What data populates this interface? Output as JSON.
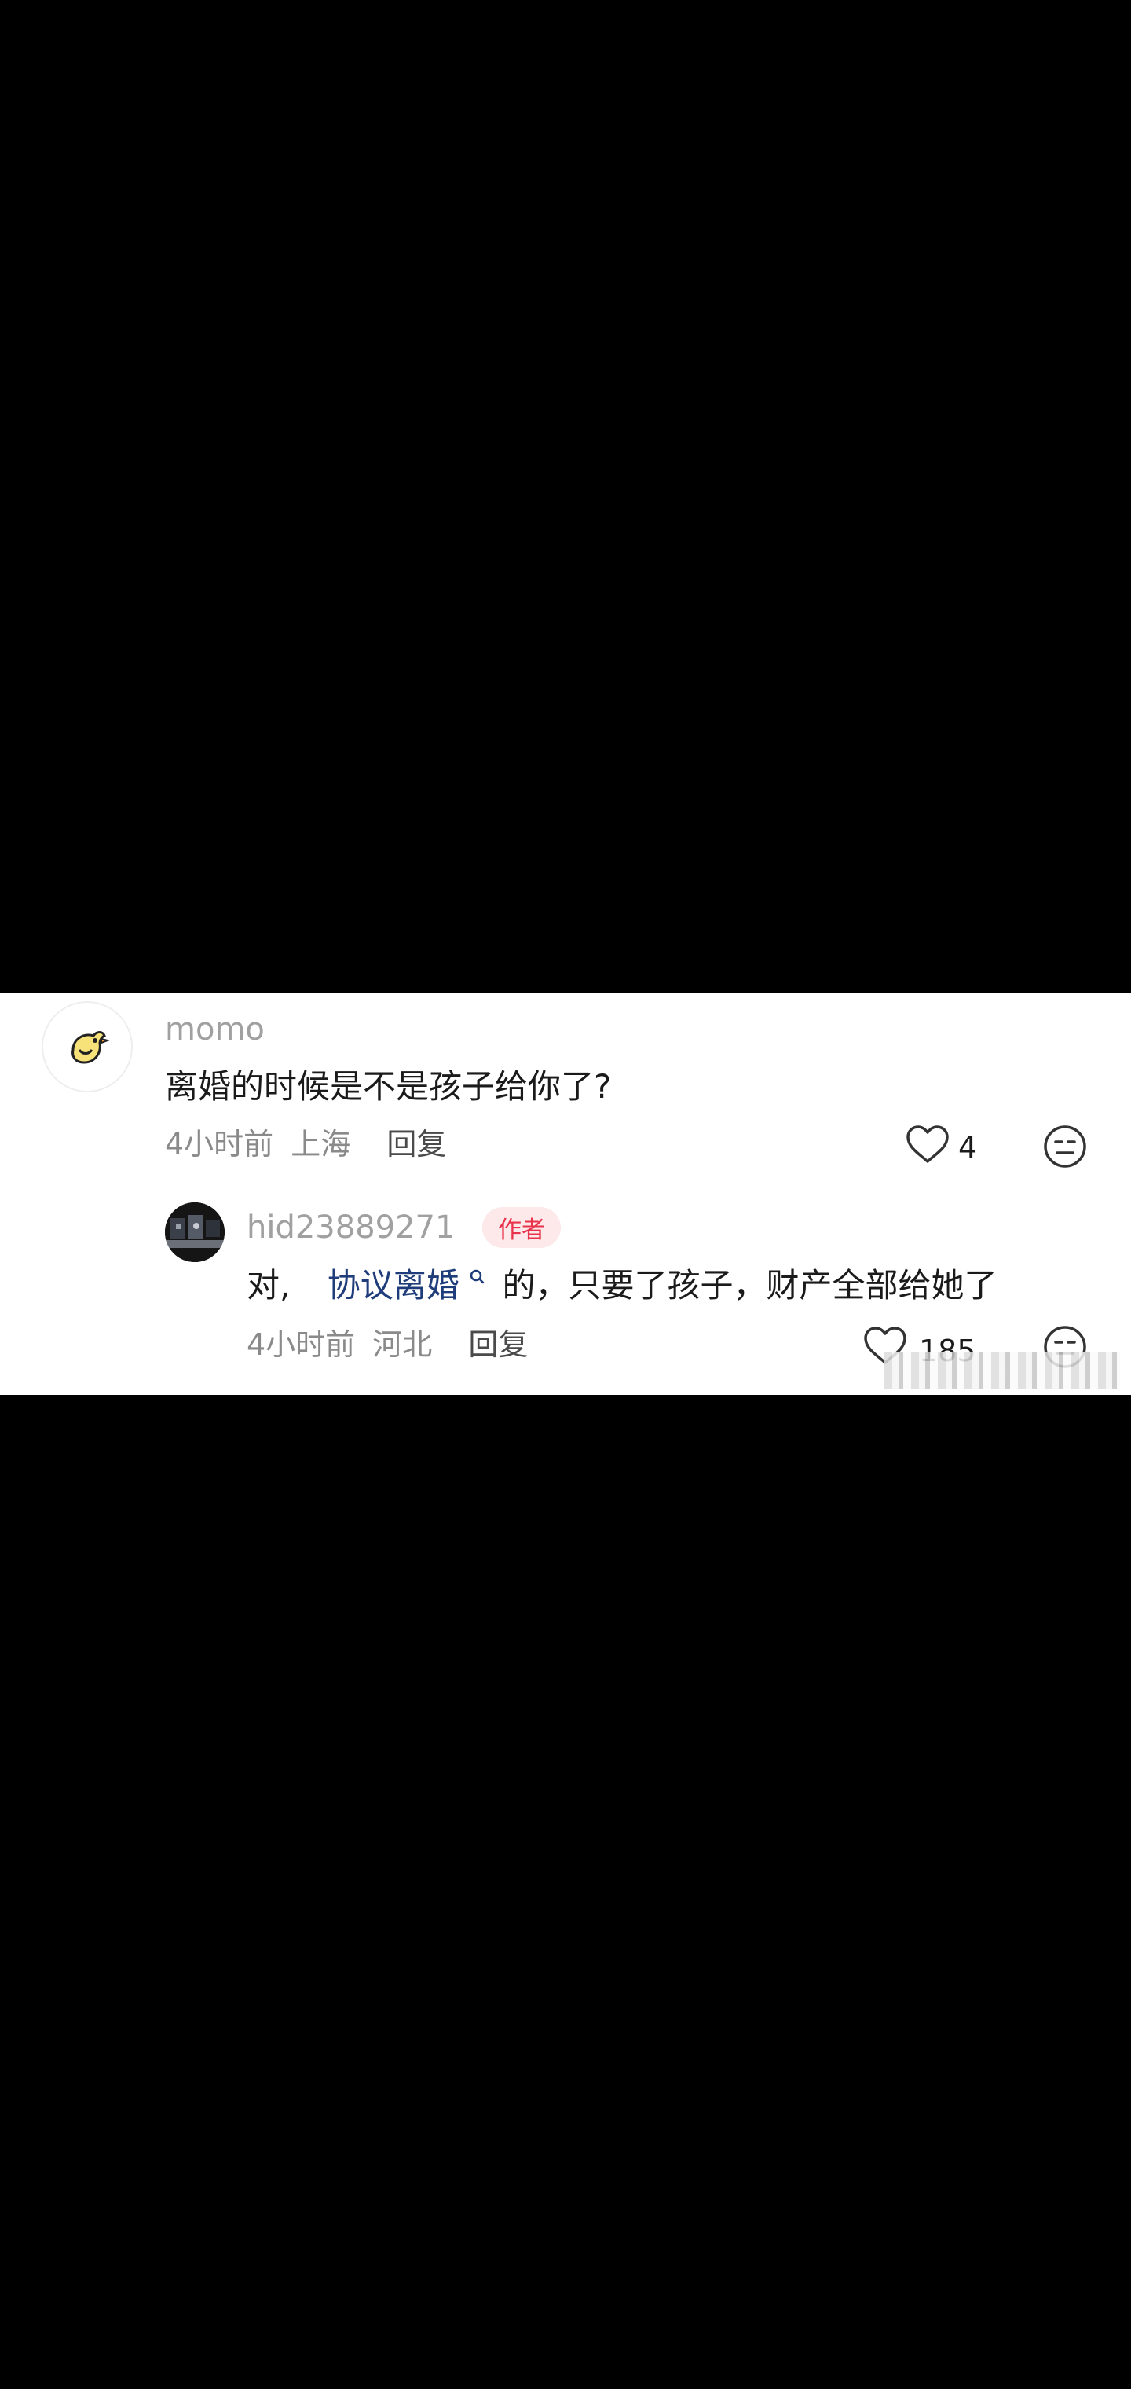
{
  "comment": {
    "username": "momo",
    "text": "离婚的时候是不是孩子给你了?",
    "time": "4小时前",
    "location": "上海",
    "reply_label": "回复",
    "like_count": "4"
  },
  "reply": {
    "username": "hid23889271",
    "badge": "作者",
    "text_prefix": "对,",
    "link_term": "协议离婚",
    "text_suffix": "的，只要了孩子，财产全部给她了",
    "time": "4小时前",
    "location": "河北",
    "reply_label": "回复",
    "like_count": "185"
  },
  "colors": {
    "background": "#000000",
    "panel": "#ffffff",
    "badge_bg": "#fde8ea",
    "badge_text": "#e8334a",
    "link": "#1f3d7a"
  },
  "icons": [
    "chick-avatar-icon",
    "heart-icon",
    "dislike-face-icon",
    "search-small-icon"
  ]
}
